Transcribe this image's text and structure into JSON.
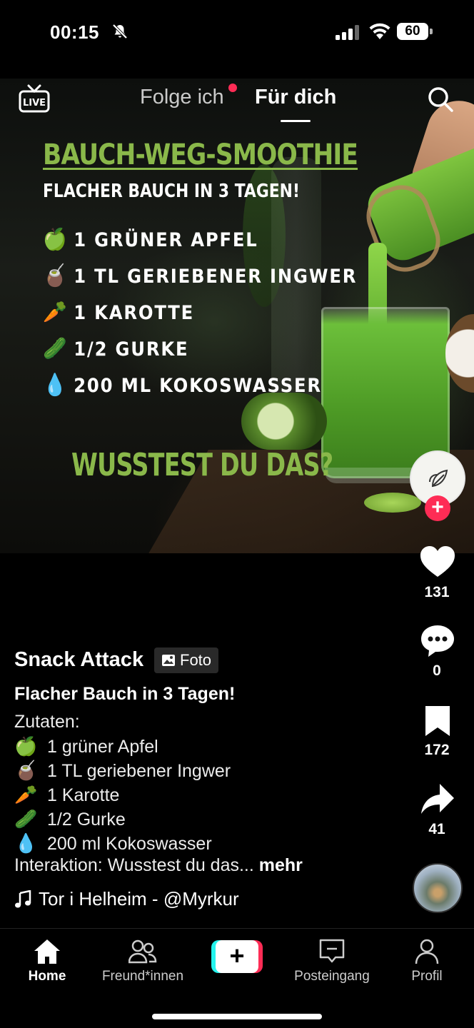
{
  "status_bar": {
    "time": "00:15",
    "battery": "60"
  },
  "top_nav": {
    "live_label": "LIVE",
    "tab_following": "Folge ich",
    "tab_foryou": "Für dich"
  },
  "post_image": {
    "headline": "BAUCH-WEG-SMOOTHIE",
    "subheadline": "FLACHER BAUCH IN 3 TAGEN!",
    "ingredients": [
      {
        "emoji": "🍏",
        "text": "1 GRÜNER APFEL"
      },
      {
        "emoji": "🧉",
        "text": "1 TL GERIEBENER INGWER"
      },
      {
        "emoji": "🥕",
        "text": "1 KAROTTE"
      },
      {
        "emoji": "🥒",
        "text": "1/2 GURKE"
      },
      {
        "emoji": "💧",
        "text": "200 ML KOKOSWASSER"
      }
    ],
    "question": "WUSSTEST DU DAS?"
  },
  "side_rail": {
    "likes": "131",
    "comments": "0",
    "saves": "172",
    "shares": "41"
  },
  "caption": {
    "author": "Snack Attack",
    "badge": "Foto",
    "title": "Flacher Bauch in 3 Tagen!",
    "intro": "Zutaten:",
    "lines": [
      {
        "emoji": "🍏",
        "text": "1 grüner Apfel"
      },
      {
        "emoji": "🧉",
        "text": "1 TL geriebener Ingwer"
      },
      {
        "emoji": "🥕",
        "text": "1 Karotte"
      },
      {
        "emoji": "🥒",
        "text": "1/2 Gurke"
      },
      {
        "emoji": "💧",
        "text": "200 ml Kokoswasser"
      }
    ],
    "last_line": "Interaktion: Wusstest du das...",
    "more": "mehr",
    "music": "Tor i Helheim - @Myrkur"
  },
  "bottom_nav": {
    "home": "Home",
    "friends": "Freund*innen",
    "inbox": "Posteingang",
    "profile": "Profil"
  },
  "colors": {
    "accent_green": "#8ab84a",
    "brand_red": "#fe2c55",
    "brand_cyan": "#25f4ee"
  }
}
